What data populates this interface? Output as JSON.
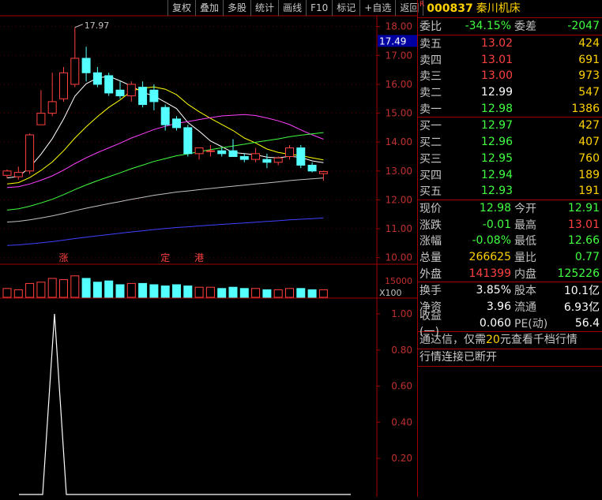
{
  "toolbar": [
    "复权",
    "叠加",
    "多股",
    "统计",
    "画线",
    "F10",
    "标记",
    "+自选",
    "返回"
  ],
  "price_axis": [
    "18.00",
    "17.00",
    "16.00",
    "15.00",
    "14.00",
    "13.00",
    "12.00",
    "11.00",
    "10.00"
  ],
  "current_price_tag": "17.49",
  "high_annotation": "17.97",
  "event_markers": [
    "涨",
    "定",
    "港"
  ],
  "volume_axis": "15000",
  "volume_unit": "X100",
  "indicator_axis": [
    "1.00",
    "0.80",
    "0.60",
    "0.40",
    "0.20"
  ],
  "stock": {
    "flag": "R",
    "code": "000837",
    "name": "秦川机床"
  },
  "weibi": {
    "label": "委比",
    "value": "-34.15%",
    "label2": "委差",
    "value2": "-2047"
  },
  "sell": [
    {
      "label": "卖五",
      "price": "13.02",
      "vol": "424",
      "color": "red"
    },
    {
      "label": "卖四",
      "price": "13.01",
      "vol": "691",
      "color": "red"
    },
    {
      "label": "卖三",
      "price": "13.00",
      "vol": "973",
      "color": "red"
    },
    {
      "label": "卖二",
      "price": "12.99",
      "vol": "547",
      "color": "white"
    },
    {
      "label": "卖一",
      "price": "12.98",
      "vol": "1386",
      "color": "green"
    }
  ],
  "buy": [
    {
      "label": "买一",
      "price": "12.97",
      "vol": "427",
      "color": "green"
    },
    {
      "label": "买二",
      "price": "12.96",
      "vol": "407",
      "color": "green"
    },
    {
      "label": "买三",
      "price": "12.95",
      "vol": "760",
      "color": "green"
    },
    {
      "label": "买四",
      "price": "12.94",
      "vol": "189",
      "color": "green"
    },
    {
      "label": "买五",
      "price": "12.93",
      "vol": "191",
      "color": "green"
    }
  ],
  "quote": [
    {
      "l1": "现价",
      "v1": "12.98",
      "c1": "green",
      "l2": "今开",
      "v2": "12.91",
      "c2": "green"
    },
    {
      "l1": "涨跌",
      "v1": "-0.01",
      "c1": "green",
      "l2": "最高",
      "v2": "13.01",
      "c2": "red"
    },
    {
      "l1": "涨幅",
      "v1": "-0.08%",
      "c1": "green",
      "l2": "最低",
      "v2": "12.66",
      "c2": "green"
    },
    {
      "l1": "总量",
      "v1": "266625",
      "c1": "yellow",
      "l2": "量比",
      "v2": "0.77",
      "c2": "green"
    },
    {
      "l1": "外盘",
      "v1": "141399",
      "c1": "red",
      "l2": "内盘",
      "v2": "125226",
      "c2": "green"
    }
  ],
  "fin": [
    {
      "l1": "换手",
      "v1": "3.85%",
      "l2": "股本",
      "v2": "10.1亿"
    },
    {
      "l1": "净资",
      "v1": "3.96",
      "l2": "流通",
      "v2": "6.93亿"
    },
    {
      "l1": "收益(一)",
      "v1": "0.060",
      "l2": "PE(动)",
      "v2": "56.4"
    }
  ],
  "message1": {
    "pre": "通达信，仅需",
    "hl": "20",
    "post": "元查看千档行情"
  },
  "message2": "行情连接已断开",
  "colors": {
    "up": "#ff4040",
    "down": "#54ffff",
    "grid": "#a00000",
    "ma5": "#ffffff",
    "ma10": "#ffff00",
    "ma20": "#ff40ff",
    "ma30": "#40ff40",
    "ma60": "#c0c0c0",
    "ma120": "#4040ff"
  },
  "candles": [
    {
      "o": 12.85,
      "h": 13.05,
      "l": 12.75,
      "c": 13.0
    },
    {
      "o": 12.8,
      "h": 13.15,
      "l": 12.7,
      "c": 12.95
    },
    {
      "o": 13.0,
      "h": 14.3,
      "l": 12.9,
      "c": 14.25
    },
    {
      "o": 14.6,
      "h": 15.8,
      "l": 14.6,
      "c": 15.0
    },
    {
      "o": 15.0,
      "h": 16.4,
      "l": 14.9,
      "c": 15.4
    },
    {
      "o": 15.5,
      "h": 16.6,
      "l": 15.4,
      "c": 16.4
    },
    {
      "o": 16.0,
      "h": 17.97,
      "l": 15.9,
      "c": 16.9
    },
    {
      "o": 16.9,
      "h": 17.3,
      "l": 16.1,
      "c": 16.4
    },
    {
      "o": 16.4,
      "h": 16.6,
      "l": 15.9,
      "c": 16.0
    },
    {
      "o": 16.3,
      "h": 16.4,
      "l": 15.6,
      "c": 15.7
    },
    {
      "o": 15.8,
      "h": 16.1,
      "l": 15.5,
      "c": 15.6
    },
    {
      "o": 15.6,
      "h": 16.1,
      "l": 15.4,
      "c": 16.0
    },
    {
      "o": 15.9,
      "h": 16.1,
      "l": 15.2,
      "c": 15.3
    },
    {
      "o": 15.8,
      "h": 16.0,
      "l": 15.1,
      "c": 15.4
    },
    {
      "o": 15.2,
      "h": 15.3,
      "l": 14.4,
      "c": 14.6
    },
    {
      "o": 14.8,
      "h": 14.9,
      "l": 14.4,
      "c": 14.5
    },
    {
      "o": 14.5,
      "h": 14.6,
      "l": 13.5,
      "c": 13.6
    },
    {
      "o": 13.6,
      "h": 13.8,
      "l": 13.4,
      "c": 13.8
    },
    {
      "o": 13.7,
      "h": 13.9,
      "l": 13.5,
      "c": 13.7
    },
    {
      "o": 13.7,
      "h": 13.8,
      "l": 13.5,
      "c": 13.6
    },
    {
      "o": 13.7,
      "h": 14.1,
      "l": 13.5,
      "c": 13.5
    },
    {
      "o": 13.5,
      "h": 13.6,
      "l": 13.3,
      "c": 13.4
    },
    {
      "o": 13.4,
      "h": 13.8,
      "l": 13.3,
      "c": 13.6
    },
    {
      "o": 13.4,
      "h": 13.6,
      "l": 13.1,
      "c": 13.3
    },
    {
      "o": 13.3,
      "h": 13.5,
      "l": 13.2,
      "c": 13.45
    },
    {
      "o": 13.5,
      "h": 13.9,
      "l": 13.4,
      "c": 13.8
    },
    {
      "o": 13.8,
      "h": 13.9,
      "l": 13.1,
      "c": 13.2
    },
    {
      "o": 13.2,
      "h": 13.3,
      "l": 12.95,
      "c": 13.0
    },
    {
      "o": 12.91,
      "h": 13.01,
      "l": 12.66,
      "c": 12.98
    }
  ],
  "volumes": [
    0.35,
    0.3,
    0.55,
    0.6,
    0.75,
    0.7,
    0.85,
    0.75,
    0.6,
    0.65,
    0.5,
    0.55,
    0.55,
    0.5,
    0.45,
    0.5,
    0.45,
    0.4,
    0.4,
    0.35,
    0.4,
    0.35,
    0.35,
    0.3,
    0.3,
    0.35,
    0.35,
    0.3,
    0.3
  ],
  "indicator": [
    0,
    0,
    0,
    1,
    0,
    0,
    0,
    0,
    0,
    0,
    0,
    0,
    0,
    0,
    0,
    0,
    0,
    0,
    0,
    0,
    0,
    0,
    0,
    0,
    0,
    0,
    0,
    0,
    0
  ]
}
